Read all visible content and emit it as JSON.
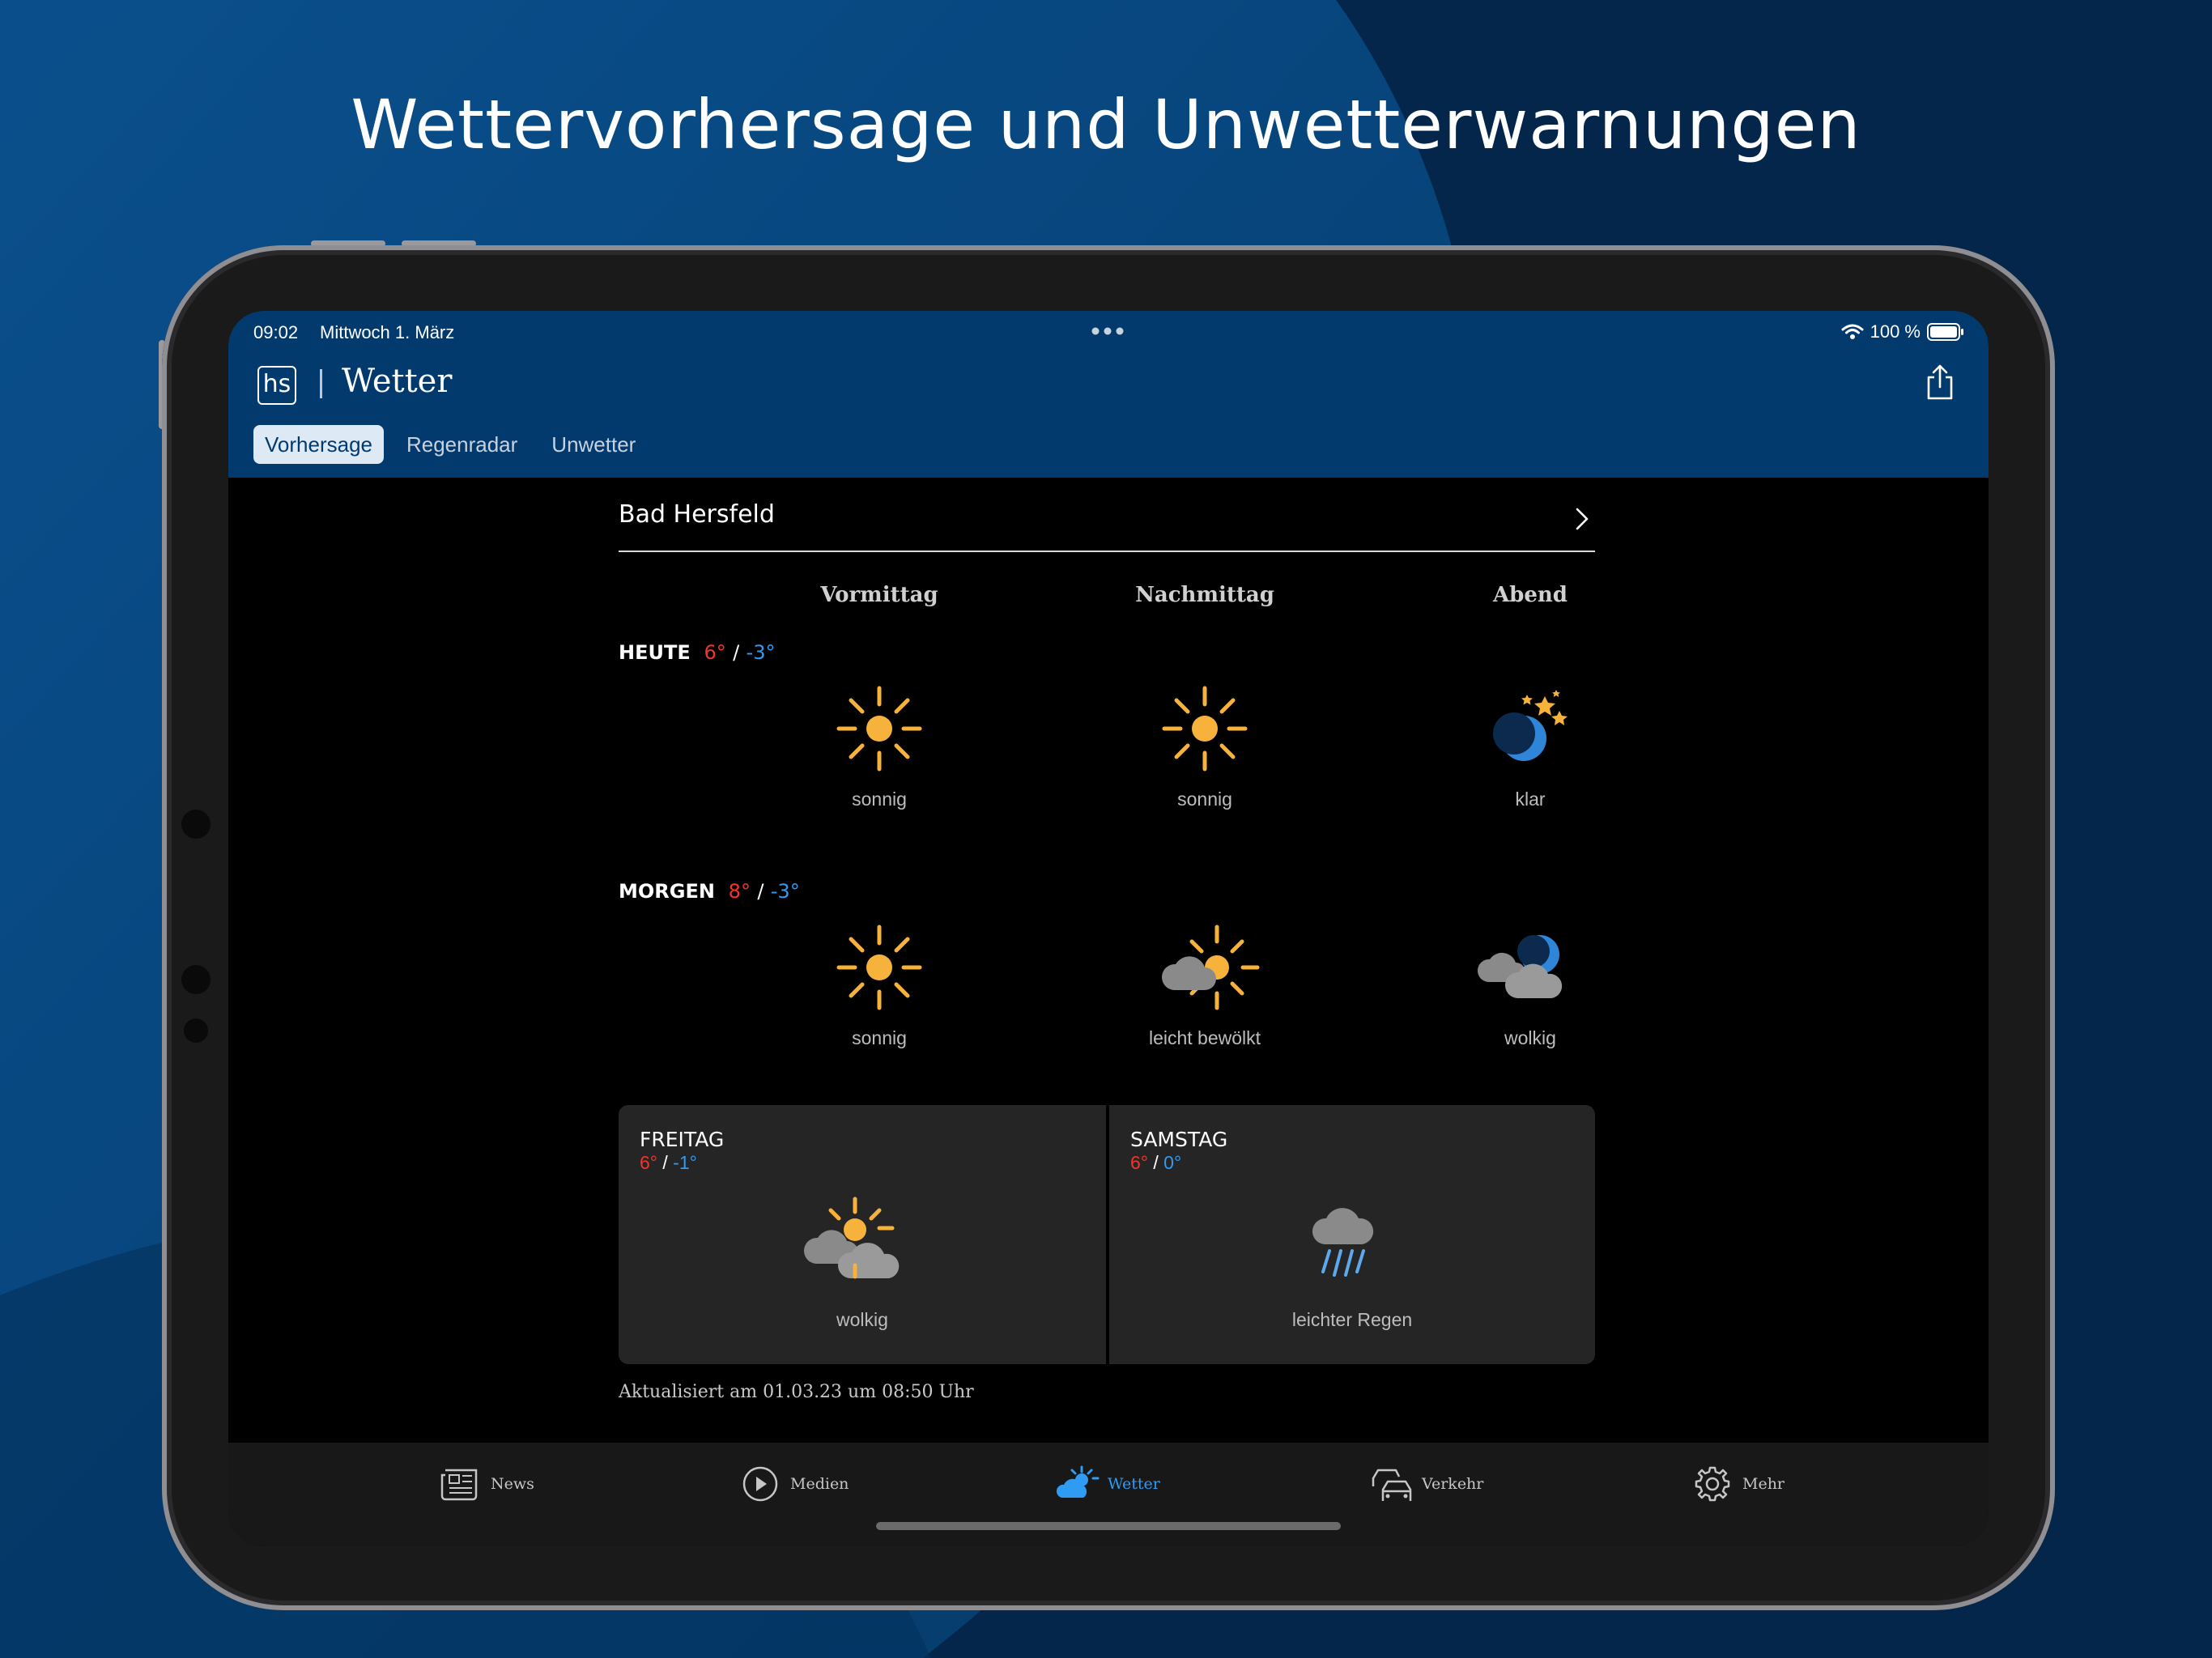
{
  "promo": {
    "title": "Wettervorhersage und Unwetterwarnungen"
  },
  "status_bar": {
    "time": "09:02",
    "date": "Mittwoch 1. März",
    "battery": "100 %"
  },
  "header": {
    "logo": "hs",
    "title": "Wetter"
  },
  "tabs": [
    {
      "label": "Vorhersage",
      "active": true
    },
    {
      "label": "Regenradar",
      "active": false
    },
    {
      "label": "Unwetter",
      "active": false
    }
  ],
  "location": {
    "name": "Bad Hersfeld"
  },
  "columns": [
    "Vormittag",
    "Nachmittag",
    "Abend"
  ],
  "days": [
    {
      "label": "HEUTE",
      "high": "6°",
      "low": "-3°",
      "periods": [
        {
          "icon": "sun-icon",
          "desc": "sonnig"
        },
        {
          "icon": "sun-icon",
          "desc": "sonnig"
        },
        {
          "icon": "moon-stars-icon",
          "desc": "klar"
        }
      ]
    },
    {
      "label": "MORGEN",
      "high": "8°",
      "low": "-3°",
      "periods": [
        {
          "icon": "sun-icon",
          "desc": "sonnig"
        },
        {
          "icon": "sun-cloud-icon",
          "desc": "leicht bewölkt"
        },
        {
          "icon": "moon-clouds-icon",
          "desc": "wolkig"
        }
      ]
    }
  ],
  "outlook": [
    {
      "day": "FREITAG",
      "high": "6°",
      "low": "-1°",
      "icon": "sun-clouds-icon",
      "desc": "wolkig"
    },
    {
      "day": "SAMSTAG",
      "high": "6°",
      "low": "0°",
      "icon": "rain-cloud-icon",
      "desc": "leichter Regen"
    }
  ],
  "updated": "Aktualisiert am 01.03.23 um 08:50 Uhr",
  "tabbar": [
    {
      "label": "News",
      "icon": "newspaper-icon",
      "active": false
    },
    {
      "label": "Medien",
      "icon": "play-icon",
      "active": false
    },
    {
      "label": "Wetter",
      "icon": "weather-icon",
      "active": true
    },
    {
      "label": "Verkehr",
      "icon": "cars-icon",
      "active": false
    },
    {
      "label": "Mehr",
      "icon": "gear-icon",
      "active": false
    }
  ],
  "colors": {
    "header_bg": "#033a6e",
    "high_temp": "#f5342e",
    "low_temp": "#2f9bf2",
    "sun": "#f6b23a",
    "active_tab": "#2f9bf2"
  }
}
